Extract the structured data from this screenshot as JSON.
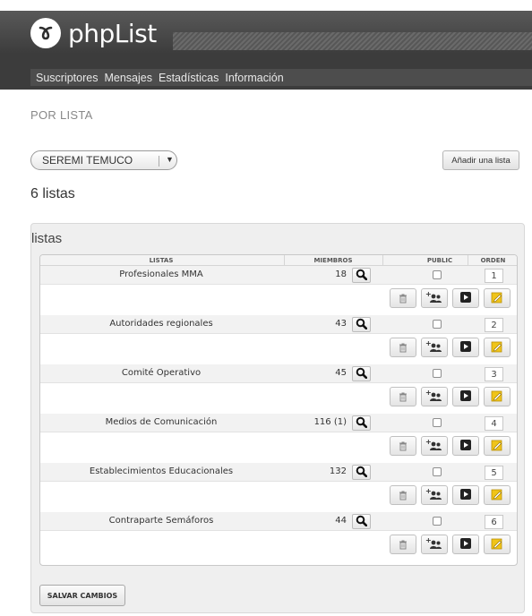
{
  "app": {
    "logo_text": "phpList"
  },
  "nav": {
    "items": [
      "Suscriptores",
      "Mensajes",
      "Estadísticas",
      "Información"
    ]
  },
  "section_title": "POR LISTA",
  "filter": {
    "selected": "SEREMI TEMUCO"
  },
  "add_list_label": "Añadir una lista",
  "list_count": "6 listas",
  "panel_title": "listas",
  "table": {
    "headers": {
      "name": "LISTAS",
      "members": "MIEMBROS",
      "public": "PUBLIC",
      "order": "ORDEN"
    },
    "rows": [
      {
        "name": "Profesionales MMA",
        "members": "18",
        "public": false,
        "order": "1"
      },
      {
        "name": "Autoridades regionales",
        "members": "43",
        "public": false,
        "order": "2"
      },
      {
        "name": "Comité Operativo",
        "members": "45",
        "public": false,
        "order": "3"
      },
      {
        "name": "Medios de Comunicación",
        "members": "116 (1)",
        "public": false,
        "order": "4"
      },
      {
        "name": "Establecimientos Educacionales",
        "members": "132",
        "public": false,
        "order": "5"
      },
      {
        "name": "Contraparte Semáforos",
        "members": "44",
        "public": false,
        "order": "6"
      }
    ]
  },
  "save_label": "SALVAR CAMBIOS",
  "colors": {
    "header_bg": "#3c3c3c",
    "nav_bg": "#4d4d4d",
    "panel_bg": "#efefef",
    "edit_icon": "#f0c419"
  }
}
